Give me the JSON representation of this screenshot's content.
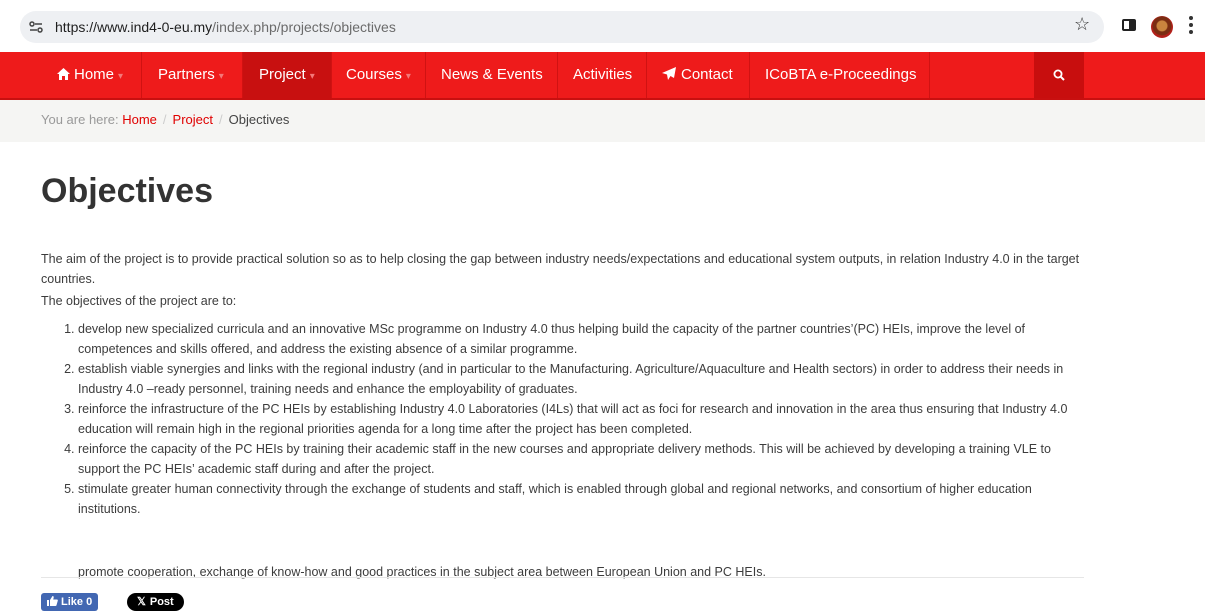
{
  "browser": {
    "url_host": "https://www.ind4-0-eu.my",
    "url_path": "/index.php/projects/objectives"
  },
  "nav": {
    "items": [
      {
        "label": "Home",
        "icon": "home-icon"
      },
      {
        "label": "Partners"
      },
      {
        "label": "Project"
      },
      {
        "label": "Courses"
      },
      {
        "label": "News & Events"
      },
      {
        "label": "Activities"
      },
      {
        "label": "Contact",
        "icon": "paper-plane-icon"
      },
      {
        "label": "ICoBTA e-Proceedings"
      }
    ],
    "accent": "#ee1b1b"
  },
  "breadcrumb": {
    "prefix": "You are here:",
    "home": "Home",
    "project": "Project",
    "current": "Objectives"
  },
  "page": {
    "title": "Objectives",
    "intro": "The aim of the project is to provide practical solution so as to help closing the gap between industry needs/expectations and educational system outputs, in relation Industry 4.0 in the target countries.",
    "lead": "The objectives of the project are to:",
    "objectives": [
      "develop new specialized curricula and an innovative MSc programme on Industry 4.0 thus helping build the capacity of the partner countries’(PC) HEIs, improve the level of competences and skills offered, and address the existing absence of a similar programme.",
      "establish viable synergies and links with the regional industry (and in particular to the Manufacturing. Agriculture/Aquaculture and Health sectors) in order to address their needs in Industry 4.0 –ready personnel, training needs and enhance the employability of graduates.",
      "reinforce the infrastructure of the PC HEIs by establishing Industry 4.0 Laboratories (I4Ls) that will act as foci for research and innovation in the area thus ensuring that Industry 4.0 education will remain high in the regional priorities agenda for a long time after the project has been completed.",
      "reinforce the capacity of the PC HEIs by training their academic staff in the new courses and appropriate delivery methods. This will be achieved by developing a training VLE to support the PC HEIs’ academic staff during and after the project.",
      "stimulate greater human connectivity through the exchange of students and staff, which is enabled through global and regional networks, and consortium of higher education institutions."
    ],
    "extra": "promote cooperation, exchange of know-how and good practices in the subject area between European Union and PC HEIs."
  },
  "social": {
    "like_label": "Like 0",
    "post_label": "Post"
  }
}
